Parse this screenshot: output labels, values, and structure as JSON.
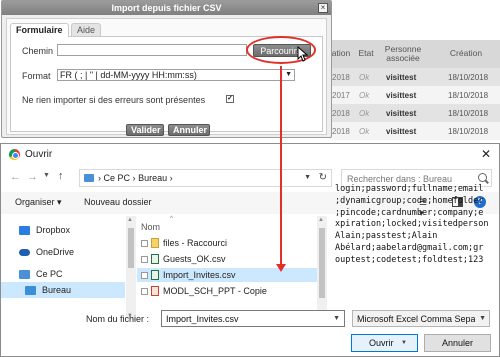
{
  "background_table": {
    "columns": [
      "ation",
      "Etat",
      "Personne associée",
      "Création"
    ],
    "rows": [
      {
        "year": "2018",
        "status": "Ok",
        "user": "visittest",
        "date": "18/10/2018"
      },
      {
        "year": "2017",
        "status": "Ok",
        "user": "visittest",
        "date": "18/10/2018"
      },
      {
        "year": "2018",
        "status": "Ok",
        "user": "visittest",
        "date": "18/10/2018"
      },
      {
        "year": "2018",
        "status": "Ok",
        "user": "visittest",
        "date": "18/10/2018"
      }
    ]
  },
  "import_dialog": {
    "title": "Import depuis fichier CSV",
    "close_label": "×",
    "tabs": [
      "Formulaire",
      "Aide"
    ],
    "chemin_label": "Chemin",
    "chemin_value": "",
    "browse_label": "Parcourir...",
    "format_label": "Format",
    "format_value": "FR ( ; | \" | dd-MM-yyyy HH:mm:ss)",
    "checkbox_label": "Ne rien importer si des erreurs sont présentes",
    "checkbox_checked": true,
    "valider_label": "Valider",
    "annuler_label": "Annuler"
  },
  "file_dialog": {
    "title": "Ouvrir",
    "close_label": "✕",
    "breadcrumb": [
      "Ce PC",
      "Bureau"
    ],
    "search_placeholder": "Rechercher dans : Bureau",
    "toolbar": {
      "organiser": "Organiser ▾",
      "new_folder": "Nouveau dossier"
    },
    "nav_items": [
      "Dropbox",
      "OneDrive",
      "Ce PC",
      "Bureau"
    ],
    "column_name": "Nom",
    "files": [
      {
        "name": "files - Raccourci",
        "kind": "shortcut",
        "selected": false
      },
      {
        "name": "Guests_OK.csv",
        "kind": "excel",
        "selected": false
      },
      {
        "name": "Import_Invites.csv",
        "kind": "excel",
        "selected": true
      },
      {
        "name": "MODL_SCH_PPT - Copie",
        "kind": "ppt",
        "selected": false
      }
    ],
    "preview_lines": [
      "login;password;fullname;email",
      ";dynamicgroup;code;homefolder",
      ";pincode;cardnumber;company;e",
      "xpiration;locked;visitedperson",
      "Alain;passtest;Alain",
      "Abélard;aabelard@gmail.com;gr",
      "ouptest;codetest;foldtest;123"
    ],
    "filename_label": "Nom du fichier :",
    "filename_value": "Import_Invites.csv",
    "filetype_value": "Microsoft Excel Comma Separa",
    "open_label": "Ouvrir",
    "cancel_label": "Annuler"
  },
  "colors": {
    "accent_red": "#e23028",
    "selection_blue": "#cce8ff",
    "button_gray": "#7a7a7a"
  }
}
